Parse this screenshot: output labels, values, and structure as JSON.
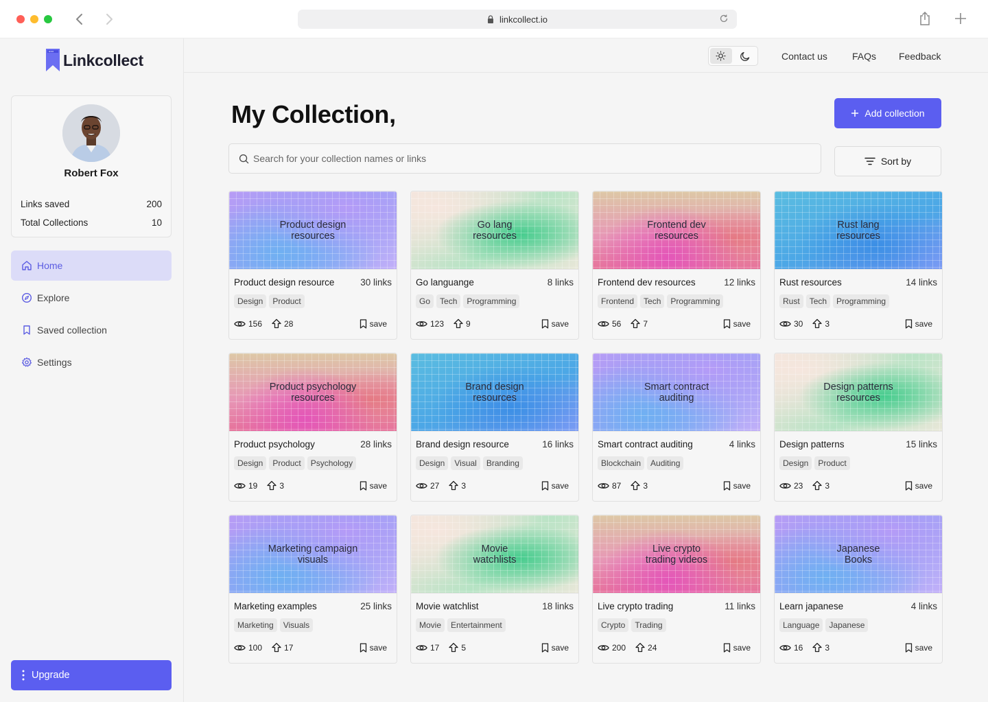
{
  "browser": {
    "url": "linkcollect.io"
  },
  "brand": {
    "name": "Linkcollect",
    "accent": "#5b5ef0"
  },
  "profile": {
    "name": "Robert Fox",
    "stats": [
      {
        "label": "Links saved",
        "value": "200"
      },
      {
        "label": "Total Collections",
        "value": "10"
      }
    ]
  },
  "menu": [
    {
      "label": "Home",
      "icon": "home-icon",
      "active": true
    },
    {
      "label": "Explore",
      "icon": "compass-icon",
      "active": false
    },
    {
      "label": "Saved collection",
      "icon": "bookmark-icon",
      "active": false
    },
    {
      "label": "Settings",
      "icon": "gear-icon",
      "active": false
    }
  ],
  "upgrade_label": "Upgrade",
  "topnav": {
    "links": [
      "Contact us",
      "FAQs",
      "Feedback"
    ]
  },
  "main": {
    "title": "My Collection,",
    "add_label": "Add collection",
    "search_placeholder": "Search for your collection names or links",
    "sort_label": "Sort by",
    "save_label": "save"
  },
  "collections": [
    {
      "cover": [
        "Product design",
        "resources"
      ],
      "name": "Product design resource",
      "links": "30 links",
      "tags": [
        "Design",
        "Product"
      ],
      "views": "156",
      "upvotes": "28",
      "theme": "purple"
    },
    {
      "cover": [
        "Go lang",
        "resources"
      ],
      "name": "Go languange",
      "links": "8 links",
      "tags": [
        "Go",
        "Tech",
        "Programming"
      ],
      "views": "123",
      "upvotes": "9",
      "theme": "green"
    },
    {
      "cover": [
        "Frontend dev",
        "resources"
      ],
      "name": "Frontend dev resources",
      "links": "12 links",
      "tags": [
        "Frontend",
        "Tech",
        "Programming"
      ],
      "views": "56",
      "upvotes": "7",
      "theme": "pink"
    },
    {
      "cover": [
        "Rust lang",
        "resources"
      ],
      "name": "Rust resources",
      "links": "14 links",
      "tags": [
        "Rust",
        "Tech",
        "Programming"
      ],
      "views": "30",
      "upvotes": "3",
      "theme": "blue"
    },
    {
      "cover": [
        "Product psychology",
        "resources"
      ],
      "name": "Product psychology",
      "links": "28 links",
      "tags": [
        "Design",
        "Product",
        "Psychology"
      ],
      "views": "19",
      "upvotes": "3",
      "theme": "pink"
    },
    {
      "cover": [
        "Brand design",
        "resources"
      ],
      "name": "Brand design resource",
      "links": "16 links",
      "tags": [
        "Design",
        "Visual",
        "Branding"
      ],
      "views": "27",
      "upvotes": "3",
      "theme": "blue"
    },
    {
      "cover": [
        "Smart contract",
        "auditing"
      ],
      "name": "Smart contract auditing",
      "links": "4 links",
      "tags": [
        "Blockchain",
        "Auditing"
      ],
      "views": "87",
      "upvotes": "3",
      "theme": "purple"
    },
    {
      "cover": [
        "Design patterns",
        "resources"
      ],
      "name": "Design patterns",
      "links": "15 links",
      "tags": [
        "Design",
        "Product"
      ],
      "views": "23",
      "upvotes": "3",
      "theme": "green"
    },
    {
      "cover": [
        "Marketing campaign",
        "visuals"
      ],
      "name": "Marketing examples",
      "links": "25 links",
      "tags": [
        "Marketing",
        "Visuals"
      ],
      "views": "100",
      "upvotes": "17",
      "theme": "purple"
    },
    {
      "cover": [
        "Movie",
        "watchlists"
      ],
      "name": "Movie watchlist",
      "links": "18 links",
      "tags": [
        "Movie",
        "Entertainment"
      ],
      "views": "17",
      "upvotes": "5",
      "theme": "green"
    },
    {
      "cover": [
        "Live crypto",
        "trading videos"
      ],
      "name": "Live crypto trading",
      "links": "11 links",
      "tags": [
        "Crypto",
        "Trading"
      ],
      "views": "200",
      "upvotes": "24",
      "theme": "pink"
    },
    {
      "cover": [
        "Japanese",
        "Books"
      ],
      "name": "Learn japanese",
      "links": "4 links",
      "tags": [
        "Language",
        "Japanese"
      ],
      "views": "16",
      "upvotes": "3",
      "theme": "purple"
    }
  ]
}
